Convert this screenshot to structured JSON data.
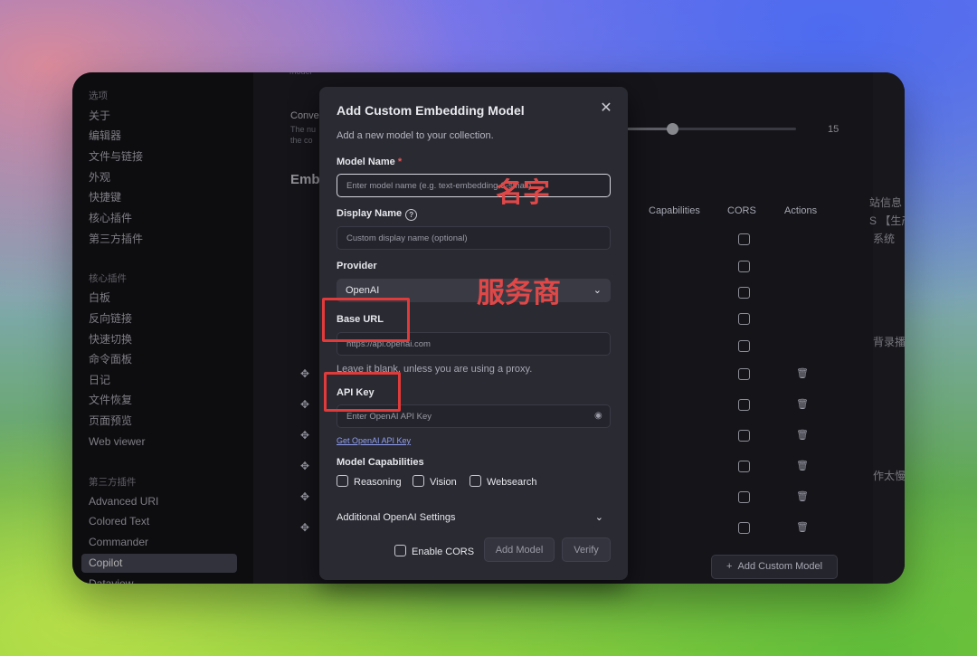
{
  "sidebar": {
    "groups": [
      {
        "title": "选项",
        "items": [
          "关于",
          "编辑器",
          "文件与链接",
          "外观",
          "快捷键",
          "核心插件",
          "第三方插件"
        ]
      },
      {
        "title": "核心插件",
        "items": [
          "白板",
          "反向链接",
          "快速切换",
          "命令面板",
          "日记",
          "文件恢复",
          "页面预览",
          "Web viewer"
        ]
      },
      {
        "title": "第三方插件",
        "items": [
          "Advanced URI",
          "Colored Text",
          "Commander",
          "Copilot",
          "Dataview"
        ]
      }
    ],
    "active_item": "Copilot"
  },
  "background_settings": {
    "slider_value": "15",
    "setting_title_partial": "Conve",
    "setting_desc_partial_1": "The nu",
    "setting_desc_partial_2": "the co",
    "top_partial": "model",
    "section_partial": "Emb",
    "table_headers": [
      "Capabilities",
      "CORS",
      "Actions"
    ],
    "add_custom_model_label": "Add Custom Model",
    "right_edge_texts": [
      "站信息",
      "S 【生产",
      "系统",
      "背录播",
      "作太慢"
    ]
  },
  "modal": {
    "title": "Add Custom Embedding Model",
    "description": "Add a new model to your collection.",
    "model_name_label": "Model Name",
    "required_mark": "*",
    "model_name_placeholder": "Enter model name (e.g. text-embedding-3-small)",
    "display_name_label": "Display Name",
    "display_name_placeholder": "Custom display name (optional)",
    "provider_label": "Provider",
    "provider_value": "OpenAI",
    "base_url_label": "Base URL",
    "base_url_placeholder": "https://api.openai.com",
    "base_url_hint": "Leave it blank, unless you are using a proxy.",
    "api_key_label": "API Key",
    "api_key_placeholder": "Enter OpenAI API Key",
    "api_key_link": "Get OpenAI API Key",
    "capabilities_label": "Model Capabilities",
    "capabilities": [
      "Reasoning",
      "Vision",
      "Websearch"
    ],
    "additional_settings_label": "Additional OpenAI Settings",
    "enable_cors_label": "Enable CORS",
    "add_model_label": "Add Model",
    "verify_label": "Verify"
  },
  "annotations": {
    "name_note": "名字",
    "provider_note": "服务商"
  },
  "colors": {
    "annotation_red": "#e03a3a",
    "active_sidebar": "#4a4a5a",
    "modal_bg": "#2a2a33"
  }
}
